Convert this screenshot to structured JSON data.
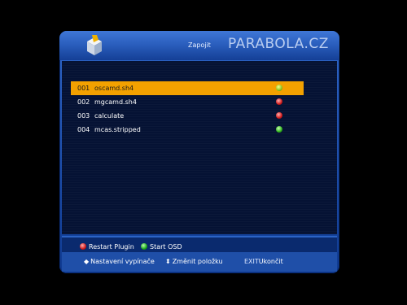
{
  "window": {
    "title": "Zapojit",
    "watermark": "PARABOLA.CZ"
  },
  "plugins": [
    {
      "num": "001",
      "name": "oscamd.sh4",
      "status": "green",
      "selected": true
    },
    {
      "num": "002",
      "name": "mgcamd.sh4",
      "status": "red",
      "selected": false
    },
    {
      "num": "003",
      "name": "calculate",
      "status": "red",
      "selected": false
    },
    {
      "num": "004",
      "name": "mcas.stripped",
      "status": "green",
      "selected": false
    }
  ],
  "footer": {
    "red_button_label": "Restart Plugin",
    "green_button_label": "Start OSD"
  },
  "hints": {
    "left_right": "Nastavení vypínače",
    "up_down": "Změnit položku",
    "exit_key": "EXIT",
    "exit_label": "Ukončit"
  },
  "colors": {
    "selection": "#f3a100",
    "panel": "#051234",
    "frame": "#2b5fbe"
  }
}
